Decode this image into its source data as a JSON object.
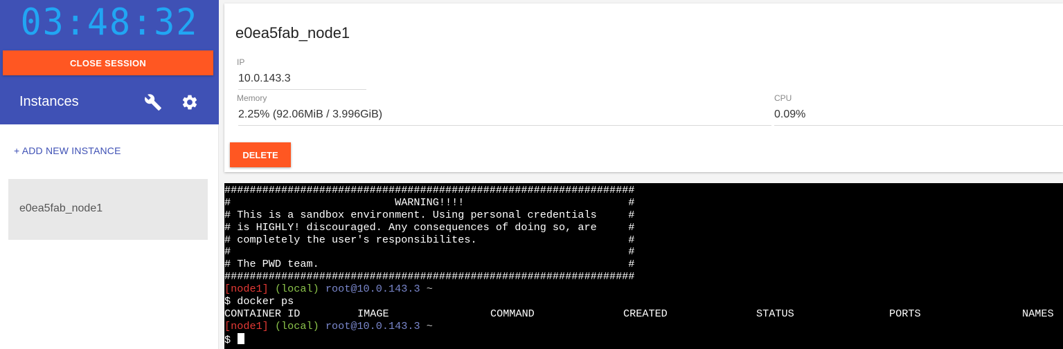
{
  "sidebar": {
    "clock": "03:48:32",
    "close_session_label": "CLOSE SESSION",
    "instances_title": "Instances",
    "add_instance_label": "+ ADD NEW INSTANCE",
    "instances": [
      {
        "name": "e0ea5fab_node1"
      }
    ],
    "colors": {
      "header_bg": "#3f51b5",
      "accent": "#ff5722",
      "clock": "#21a6f3"
    },
    "icons": {
      "tools": "wrench-icon",
      "settings": "gear-icon"
    }
  },
  "instance": {
    "name": "e0ea5fab_node1",
    "ip_label": "IP",
    "ip_value": "10.0.143.3",
    "memory_label": "Memory",
    "memory_value": "2.25% (92.06MiB / 3.996GiB)",
    "cpu_label": "CPU",
    "cpu_value": "0.09%",
    "delete_label": "DELETE"
  },
  "terminal": {
    "banner": [
      "#################################################################",
      "#                          WARNING!!!!                          #",
      "# This is a sandbox environment. Using personal credentials     #",
      "# is HIGHLY! discouraged. Any consequences of doing so, are     #",
      "# completely the user's responsibilites.                        #",
      "#                                                               #",
      "# The PWD team.                                                 #",
      "#################################################################"
    ],
    "prompt": {
      "node": "[node1]",
      "location": "(local)",
      "host": "root@10.0.143.3",
      "path": "~",
      "symbol": "$"
    },
    "command": "docker ps",
    "table_headers": [
      "CONTAINER ID",
      "IMAGE",
      "COMMAND",
      "CREATED",
      "STATUS",
      "PORTS",
      "NAMES"
    ]
  }
}
